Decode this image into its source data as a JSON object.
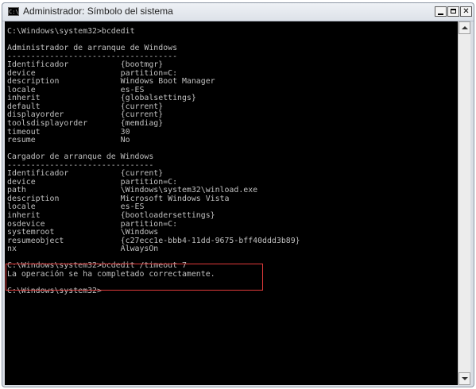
{
  "window": {
    "title": "Administrador: Símbolo del sistema",
    "icon": "cmd-icon",
    "icon_label": "C:\\"
  },
  "console": {
    "text": "C:\\Windows\\system32>bcdedit\n\nAdministrador de arranque de Windows\n------------------------------------\nIdentificador           {bootmgr}\ndevice                  partition=C:\ndescription             Windows Boot Manager\nlocale                  es-ES\ninherit                 {globalsettings}\ndefault                 {current}\ndisplayorder            {current}\ntoolsdisplayorder       {memdiag}\ntimeout                 30\nresume                  No\n\nCargador de arranque de Windows\n-------------------------------\nIdentificador           {current}\ndevice                  partition=C:\npath                    \\Windows\\system32\\winload.exe\ndescription             Microsoft Windows Vista\nlocale                  es-ES\ninherit                 {bootloadersettings}\nosdevice                partition=C:\nsystemroot              \\Windows\nresumeobject            {c27ecc1e-bbb4-11dd-9675-bff40ddd3b89}\nnx                      AlwaysOn\n\nC:\\Windows\\system32>bcdedit /timeout 7\nLa operación se ha completado correctamente.\n\nC:\\Windows\\system32>"
  },
  "colors": {
    "console_bg": "#000000",
    "console_text": "#c0c0c0",
    "highlight_border": "#e23b3b"
  }
}
